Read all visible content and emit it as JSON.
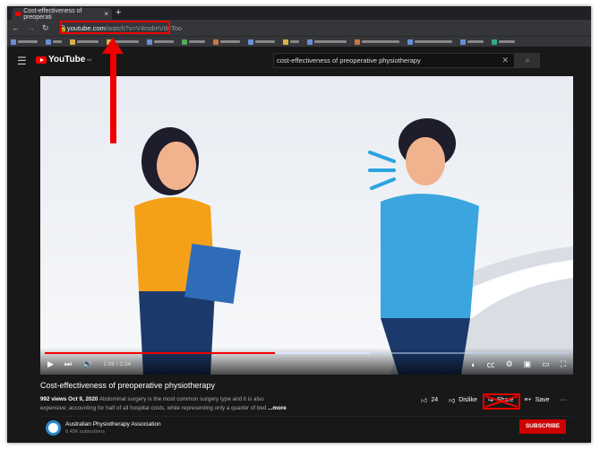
{
  "browser": {
    "tab_title": "Cost-effectiveness of preoperati",
    "url_domain": "youtube.com",
    "url_path": "/watch?v=V4mdmVdeToo"
  },
  "youtube": {
    "logo": "YouTube",
    "region": "NZ",
    "search_value": "cost-effectiveness of preoperative physiotherapy"
  },
  "player": {
    "time": "1:08 / 2:34",
    "progress_fraction": 0.44
  },
  "video": {
    "title": "Cost-effectiveness of preoperative physiotherapy",
    "views": "992 views",
    "date": "Oct 9, 2020",
    "description": "Abdominal surgery is the most common surgery type and it is also expensive; accounting for half of all hospital costs, while representing only a quarter of bed",
    "more": "...more",
    "likes": "24",
    "dislike": "Dislike",
    "share": "Share",
    "save": "Save"
  },
  "channel": {
    "name": "Australian Physiotherapy Association",
    "subscribers": "6.45K subscribers",
    "subscribe": "SUBSCRIBE"
  },
  "colors": {
    "annotation": "#e00000",
    "youtube_red": "#ff0000"
  }
}
